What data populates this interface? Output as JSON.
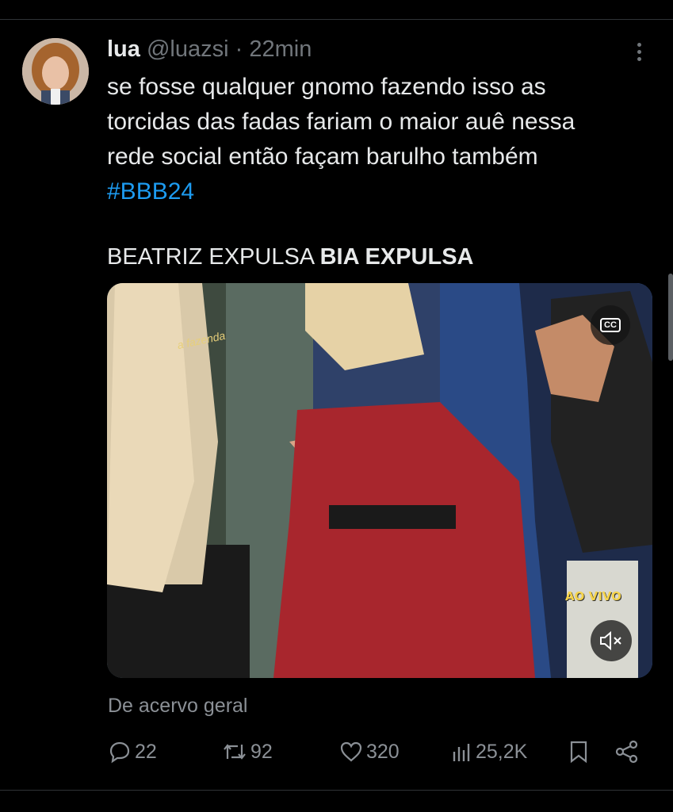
{
  "tweet": {
    "display_name": "lua",
    "handle": "@luazsi",
    "separator": "·",
    "time": "22min",
    "text_lines": [
      "se fosse qualquer gnomo fazendo isso as",
      "torcidas das fadas fariam o maior auê nessa",
      "rede social então façam barulho também"
    ],
    "hashtag": "#BBB24",
    "title_regular": "BEATRIZ EXPULSA ",
    "title_bold": "BIA EXPULSA",
    "source_label": "De acervo geral"
  },
  "video": {
    "cc_label": "CC",
    "live_label": "AO VIVO",
    "watermark": "a fazenda"
  },
  "actions": {
    "replies": "22",
    "retweets": "92",
    "likes": "320",
    "views": "25,2K"
  },
  "icons": {
    "more": "more-vertical-icon",
    "reply": "reply-icon",
    "retweet": "retweet-icon",
    "like": "heart-icon",
    "views": "views-icon",
    "bookmark": "bookmark-icon",
    "share": "share-icon",
    "mute": "speaker-muted-icon",
    "captions": "captions-icon"
  },
  "colors": {
    "background": "#000000",
    "text": "#e7e9ea",
    "muted": "#71767b",
    "link": "#1d9bf0"
  }
}
